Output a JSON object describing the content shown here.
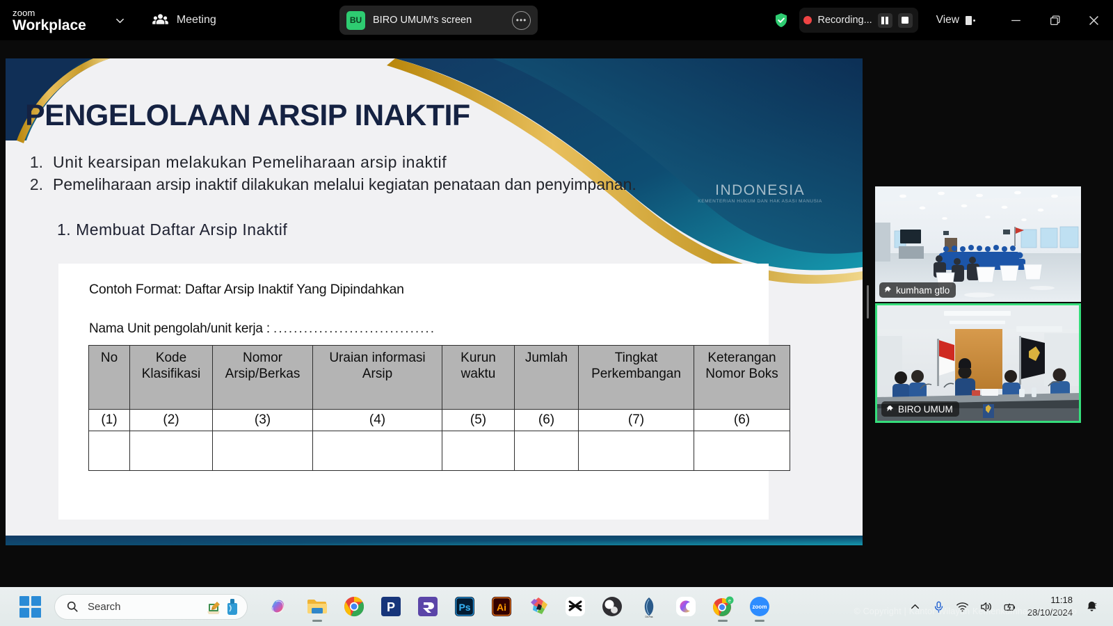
{
  "app": {
    "brand_line1": "zoom",
    "brand_line2": "Workplace",
    "meeting_label": "Meeting",
    "accent_green": "#2ecc71",
    "active_tile_border": "#35de7b"
  },
  "share_pill": {
    "avatar_initials": "BU",
    "title": "BIRO UMUM's screen",
    "more_glyph": "•••"
  },
  "recording": {
    "label": "Recording...",
    "dot_color": "#ef4444"
  },
  "view_control": {
    "label": "View"
  },
  "window_controls": {
    "minimize": "minimize",
    "restore": "restore",
    "close": "close"
  },
  "slide": {
    "title": "PENGELOLAAN ARSIP INAKTIF",
    "bullets": [
      {
        "num": "1.",
        "text": "Unit kearsipan melakukan Pemeliharaan arsip inaktif"
      },
      {
        "num": "2.",
        "text": "Pemeliharaan arsip inaktif dilakukan melalui kegiatan penataan dan penyimpanan."
      }
    ],
    "subheading": "1. Membuat Daftar Arsip Inaktif",
    "watermark": "INDONESIA",
    "watermark_sub": "KEMENTERIAN HUKUM DAN HAK ASASI MANUSIA",
    "document": {
      "title": "Contoh Format: Daftar Arsip Inaktif  Yang Dipindahkan",
      "unit_label": "Nama Unit pengolah/unit kerja :",
      "unit_dots": "................................",
      "table": {
        "headers": [
          "No",
          "Kode Klasifikasi",
          "Nomor Arsip/Berkas",
          "Uraian informasi Arsip",
          "Kurun waktu",
          "Jumlah",
          "Tingkat Perkembangan",
          "Keterangan Nomor Boks"
        ],
        "number_row": [
          "(1)",
          "(2)",
          "(3)",
          "(4)",
          "(5)",
          "(6)",
          "(7)",
          "(6)"
        ],
        "empty_row": [
          "",
          "",
          "",
          "",
          "",
          "",
          "",
          ""
        ]
      }
    }
  },
  "tiles": [
    {
      "name": "kumham gtlo",
      "active": false
    },
    {
      "name": "BIRO UMUM",
      "active": true
    }
  ],
  "taskbar": {
    "search_placeholder": "Search",
    "apps": [
      {
        "name": "copilot",
        "running": false
      },
      {
        "name": "file-explorer",
        "running": true
      },
      {
        "name": "google-chrome",
        "running": false
      },
      {
        "name": "pdf-reader",
        "running": false
      },
      {
        "name": "resilio-sync",
        "running": false
      },
      {
        "name": "adobe-photoshop",
        "running": false
      },
      {
        "name": "adobe-illustrator",
        "running": false
      },
      {
        "name": "canva",
        "running": false
      },
      {
        "name": "capcut",
        "running": false
      },
      {
        "name": "obs-studio",
        "running": false
      },
      {
        "name": "kemenkumham-app",
        "running": false
      },
      {
        "name": "clipchamp",
        "running": false
      },
      {
        "name": "google-chrome-2",
        "running": true
      },
      {
        "name": "zoom",
        "running": true
      }
    ],
    "clock_time": "11:18",
    "clock_date": "28/10/2024"
  },
  "screen_watermark": "© Copyright | Kantor Wilayah Kemenkumham Gorontalo"
}
